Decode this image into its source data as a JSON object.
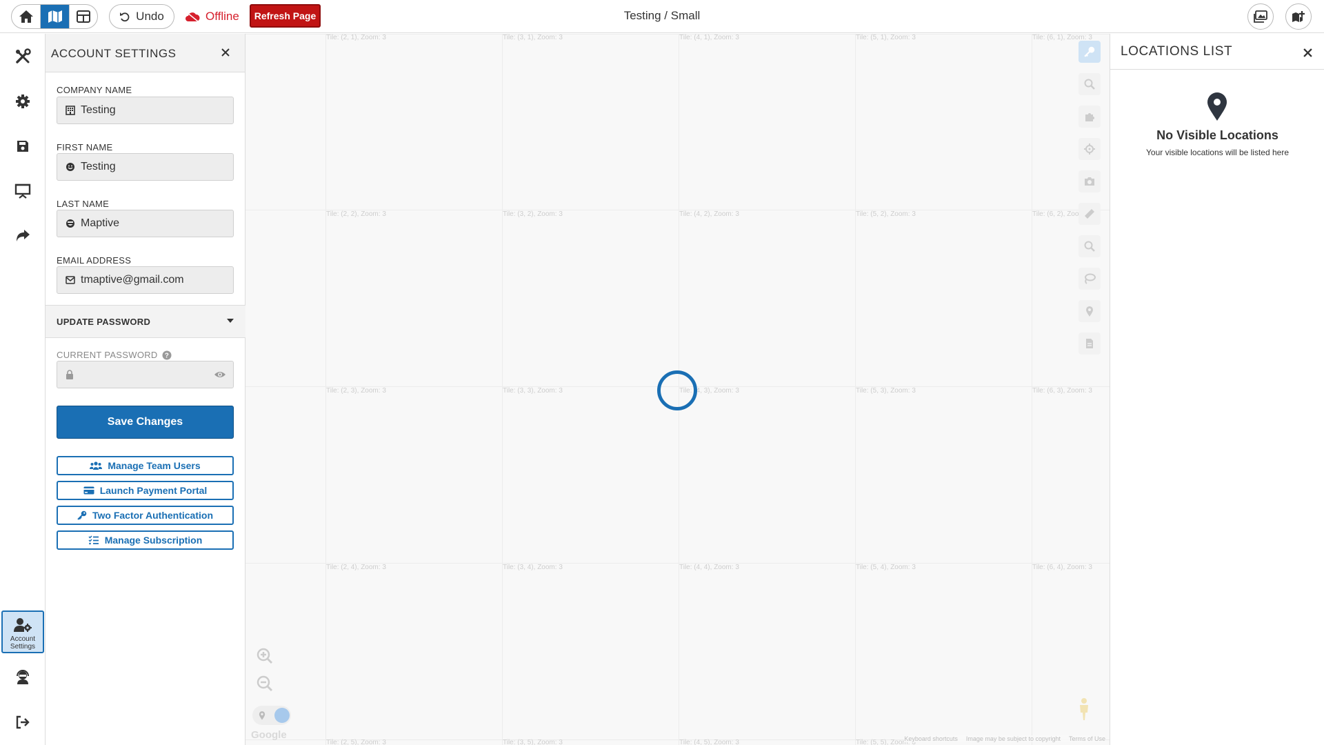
{
  "topbar": {
    "undo_label": "Undo",
    "offline_label": "Offline",
    "refresh_label": "Refresh Page",
    "title": "Testing / Small",
    "colors": {
      "accent": "#1a6fb4",
      "offline": "#d6202d",
      "refresh_bg": "#c11414"
    }
  },
  "rail": {
    "icons": [
      "tools-icon",
      "gear-icon",
      "save-icon",
      "presentation-icon",
      "share-icon",
      "account-settings-icon",
      "support-agent-icon",
      "logout-icon"
    ],
    "active_label": "Account Settings"
  },
  "account": {
    "title": "ACCOUNT SETTINGS",
    "company_label": "COMPANY NAME",
    "company_value": "Testing",
    "first_label": "FIRST NAME",
    "first_value": "Testing",
    "last_label": "LAST NAME",
    "last_value": "Maptive",
    "email_label": "EMAIL ADDRESS",
    "email_value": "tmaptive@gmail.com",
    "password_section": "UPDATE PASSWORD",
    "current_password_label": "CURRENT PASSWORD",
    "current_password_value": "",
    "save_label": "Save Changes",
    "buttons": [
      {
        "label": "Manage Team Users",
        "icon": "users-icon"
      },
      {
        "label": "Launch Payment Portal",
        "icon": "credit-card-icon"
      },
      {
        "label": "Two Factor Authentication",
        "icon": "key-icon"
      },
      {
        "label": "Manage Subscription",
        "icon": "list-check-icon"
      }
    ]
  },
  "map": {
    "tiles": [
      [
        "Tile: (2, 1), Zoom: 3",
        "Tile: (3, 1), Zoom: 3",
        "Tile: (4, 1), Zoom: 3",
        "Tile: (5, 1), Zoom: 3",
        "Tile: (6, 1), Zoom: 3"
      ],
      [
        "Tile: (2, 2), Zoom: 3",
        "Tile: (3, 2), Zoom: 3",
        "Tile: (4, 2), Zoom: 3",
        "Tile: (5, 2), Zoom: 3",
        "Tile: (6, 2), Zoom: 3"
      ],
      [
        "Tile: (2, 3), Zoom: 3",
        "Tile: (3, 3), Zoom: 3",
        "Tile: (4, 3), Zoom: 3",
        "Tile: (5, 3), Zoom: 3",
        "Tile: (6, 3), Zoom: 3"
      ],
      [
        "Tile: (2, 4), Zoom: 3",
        "Tile: (3, 4), Zoom: 3",
        "Tile: (4, 4), Zoom: 3",
        "Tile: (5, 4), Zoom: 3",
        "Tile: (6, 4), Zoom: 3"
      ],
      [
        "Tile: (2, 5), Zoom: 3",
        "Tile: (3, 5), Zoom: 3",
        "Tile: (4, 5), Zoom: 3",
        "Tile: (5, 5), Zoom: 3"
      ]
    ],
    "tools": [
      "key-icon",
      "search-icon",
      "puzzle-icon",
      "crosshair-icon",
      "camera-icon",
      "ruler-icon",
      "zoom-search-icon",
      "lasso-icon",
      "map-pin-icon",
      "document-icon"
    ],
    "google_label": "Google",
    "attribution": [
      "Keyboard shortcuts",
      "Image may be subject to copyright",
      "Terms of Use"
    ]
  },
  "locations": {
    "title": "LOCATIONS LIST",
    "empty_title": "No Visible Locations",
    "empty_sub": "Your visible locations will be listed here"
  }
}
